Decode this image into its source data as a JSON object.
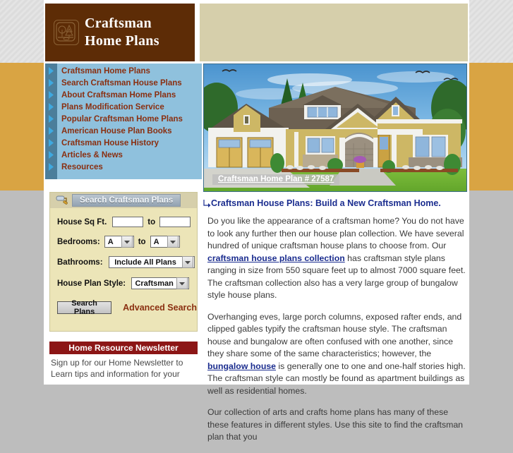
{
  "brand": {
    "logo_icon": "trees-landscape-icon",
    "title_line1": "Craftsman",
    "title_line2": "Home Plans"
  },
  "nav": {
    "arrow_icon": "chevron-right-icon",
    "items": [
      {
        "label": "Craftsman Home Plans"
      },
      {
        "label": "Search Craftsman House Plans"
      },
      {
        "label": "About Craftsman Home Plans"
      },
      {
        "label": "Plans Modification Service"
      },
      {
        "label": "Popular Craftsman Home Plans"
      },
      {
        "label": "American House Plan Books"
      },
      {
        "label": "Craftsman House History"
      },
      {
        "label": "Articles & News"
      },
      {
        "label": "Resources"
      }
    ]
  },
  "hero": {
    "caption": "Craftsman Home Plan # 27587"
  },
  "search": {
    "header_icon": "paint-roller-icon",
    "header_label": "Search Craftsman Plans",
    "sqft_label": "House Sq Ft.",
    "sqft_min_value": "",
    "sqft_min_placeholder": "",
    "sqft_max_value": "",
    "sqft_max_placeholder": "",
    "to_word": "to",
    "bedrooms_label": "Bedrooms:",
    "bedrooms_min_value": "A",
    "bedrooms_max_value": "A",
    "bathrooms_label": "Bathrooms:",
    "bathrooms_value": "Include All Plans",
    "style_label": "House Plan Style:",
    "style_value": "Craftsman",
    "search_button": "Search Plans",
    "advanced_link": "Advanced Search",
    "dropdown_icon": "chevron-down-icon"
  },
  "newsletter": {
    "title": "Home Resource Newsletter",
    "line1": "Sign up for our Home Newsletter to",
    "line2": "Learn tips and information for your"
  },
  "content": {
    "heading_icon": "corner-arrow-icon",
    "heading": "Craftsman House Plans: Build a New Craftsman Home.",
    "p1_before": "Do you like the appearance of a craftsman home? You do not have to look any further then our house plan collection. We have several hundred of unique craftsman house plans to choose from. Our ",
    "p1_link": "craftsman house plans collection",
    "p1_after": " has craftsman style plans ranging in size from 550 square feet up to almost 7000 square feet. The craftsman collection also has a very large group of bungalow style house plans.",
    "p2_before": "Overhanging eves, large porch columns, exposed rafter ends, and clipped gables typify the craftsman house style. The craftsman house and bungalow are often confused with one another, since they share some of the same characteristics; however, the ",
    "p2_link": "bungalow house",
    "p2_after": " is generally one to one and one-half stories high. The craftsman style can mostly be found as apartment buildings as well as residential homes.",
    "p3": "Our collection of arts and crafts home plans has many of these these features in different styles. Use this site to find the craftsman plan that you"
  },
  "colors": {
    "brand_brown": "#5d2c06",
    "banner_beige": "#d6cfab",
    "nav_blue": "#8fc1dd",
    "nav_rail_blue": "#4c7e9b",
    "nav_link_rust": "#8a2f10",
    "page_gold": "#d9a443",
    "page_gray": "#bdbdbd",
    "panel_cream": "#ece5b8",
    "newsletter_red": "#8c1616",
    "heading_navy": "#1b2d8f"
  }
}
